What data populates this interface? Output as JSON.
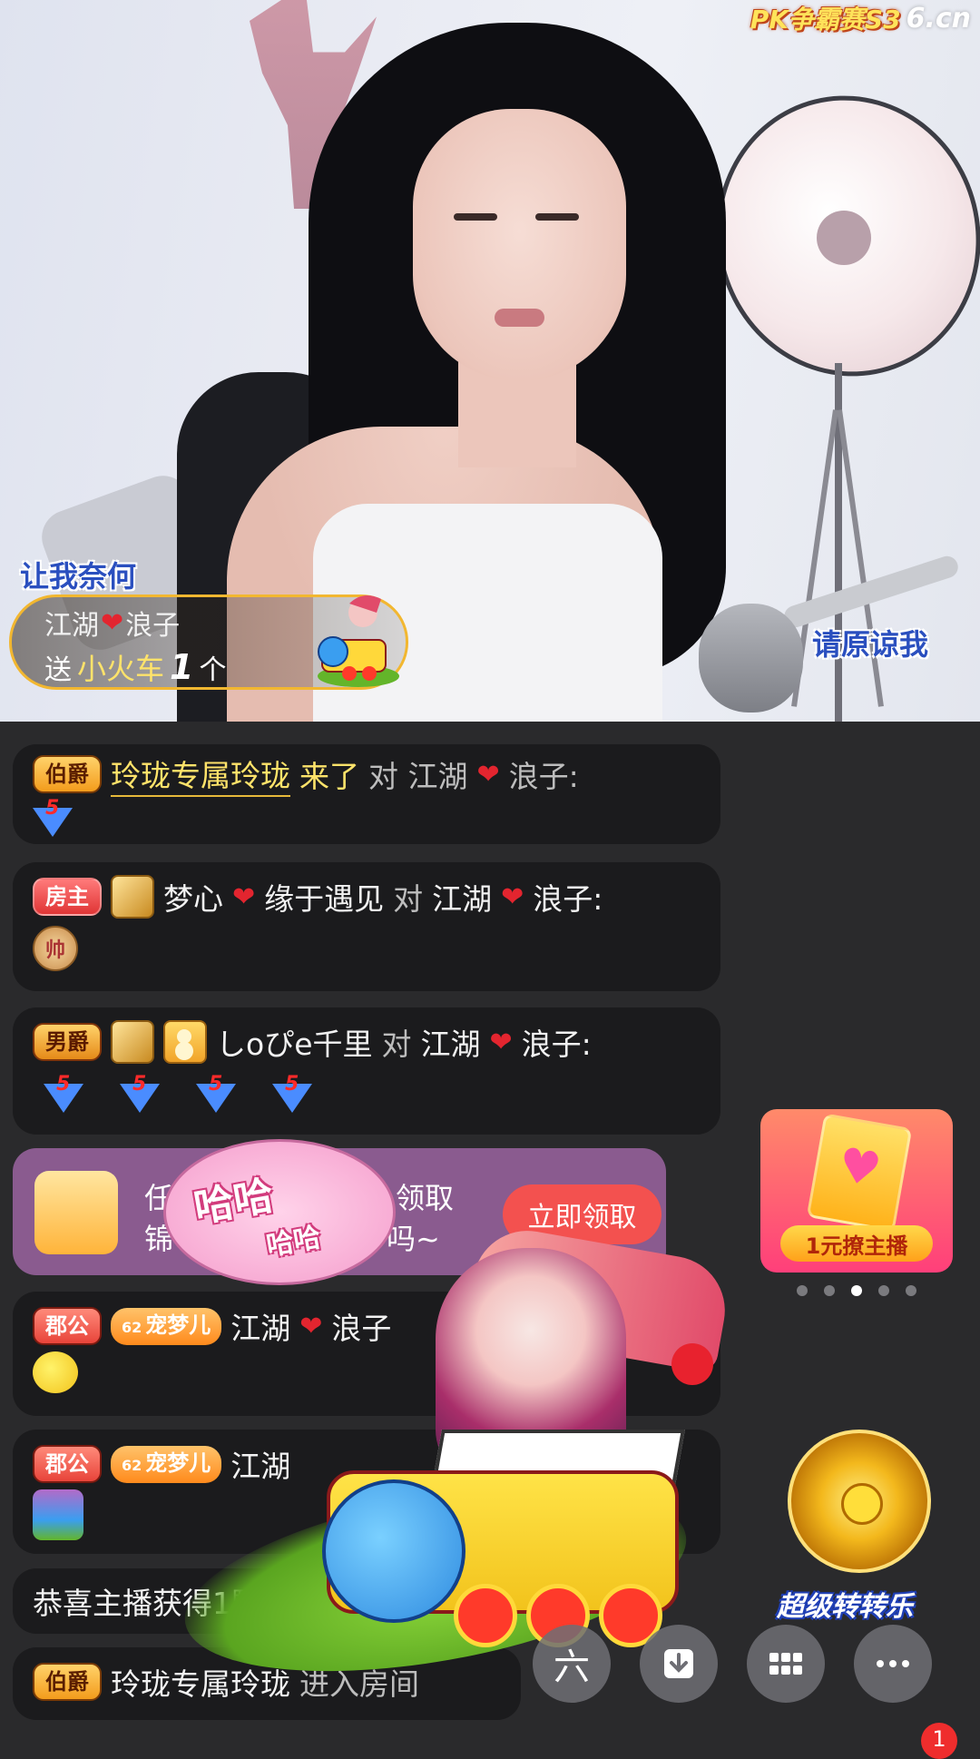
{
  "top_brand": {
    "event": "PK争霸赛S3",
    "site": "6.cn"
  },
  "stream_overlay": {
    "left_text": "让我奈何",
    "right_text": "请原谅我"
  },
  "gift_banner": {
    "sender_part1": "江湖",
    "sender_part2": "浪子",
    "send_label": "送",
    "gift_name": "小火车",
    "count": "1",
    "unit": "个"
  },
  "chat": {
    "item1": {
      "badge": "伯爵",
      "name": "玲珑专属玲珑",
      "action": "来了",
      "trailing": "对 江湖",
      "trailing2": "浪子:",
      "emote": "5"
    },
    "item2": {
      "badge": "房主",
      "name1": "梦心",
      "name2": "缘于遇见",
      "to": "对",
      "target1": "江湖",
      "target2": "浪子:",
      "emote": "帅"
    },
    "item3": {
      "badge": "男爵",
      "name": "しoぴe千里",
      "to": "对",
      "target1": "江湖",
      "target2": "浪子:",
      "emotes": [
        "5",
        "5",
        "5",
        "5"
      ]
    },
    "promo": {
      "line1_a": "任",
      "line1_b": "领取",
      "line2_a": "锦",
      "line2_b": "吗~",
      "button": "立即领取"
    },
    "bubble": {
      "big": "哈哈",
      "small": "哈哈"
    },
    "item4": {
      "badge": "郡公",
      "fan_badge": "宠梦儿",
      "fan_level": "62",
      "name1": "江湖",
      "name2": "浪子",
      "tail": "黄鸭"
    },
    "item5": {
      "badge": "郡公",
      "fan_badge": "宠梦儿",
      "fan_level": "62",
      "name1": "江湖"
    },
    "item6": {
      "text": "恭喜主播获得1颗"
    },
    "item7": {
      "badge": "伯爵",
      "name": "玲珑专属玲珑",
      "action": "进入房间"
    }
  },
  "side_banner": {
    "label": "1元撩主播",
    "dots": 5,
    "active_dot": 3
  },
  "wheel": {
    "label": "超级转转乐"
  },
  "actions": {
    "share_icon": "六",
    "notification_count": "1"
  }
}
